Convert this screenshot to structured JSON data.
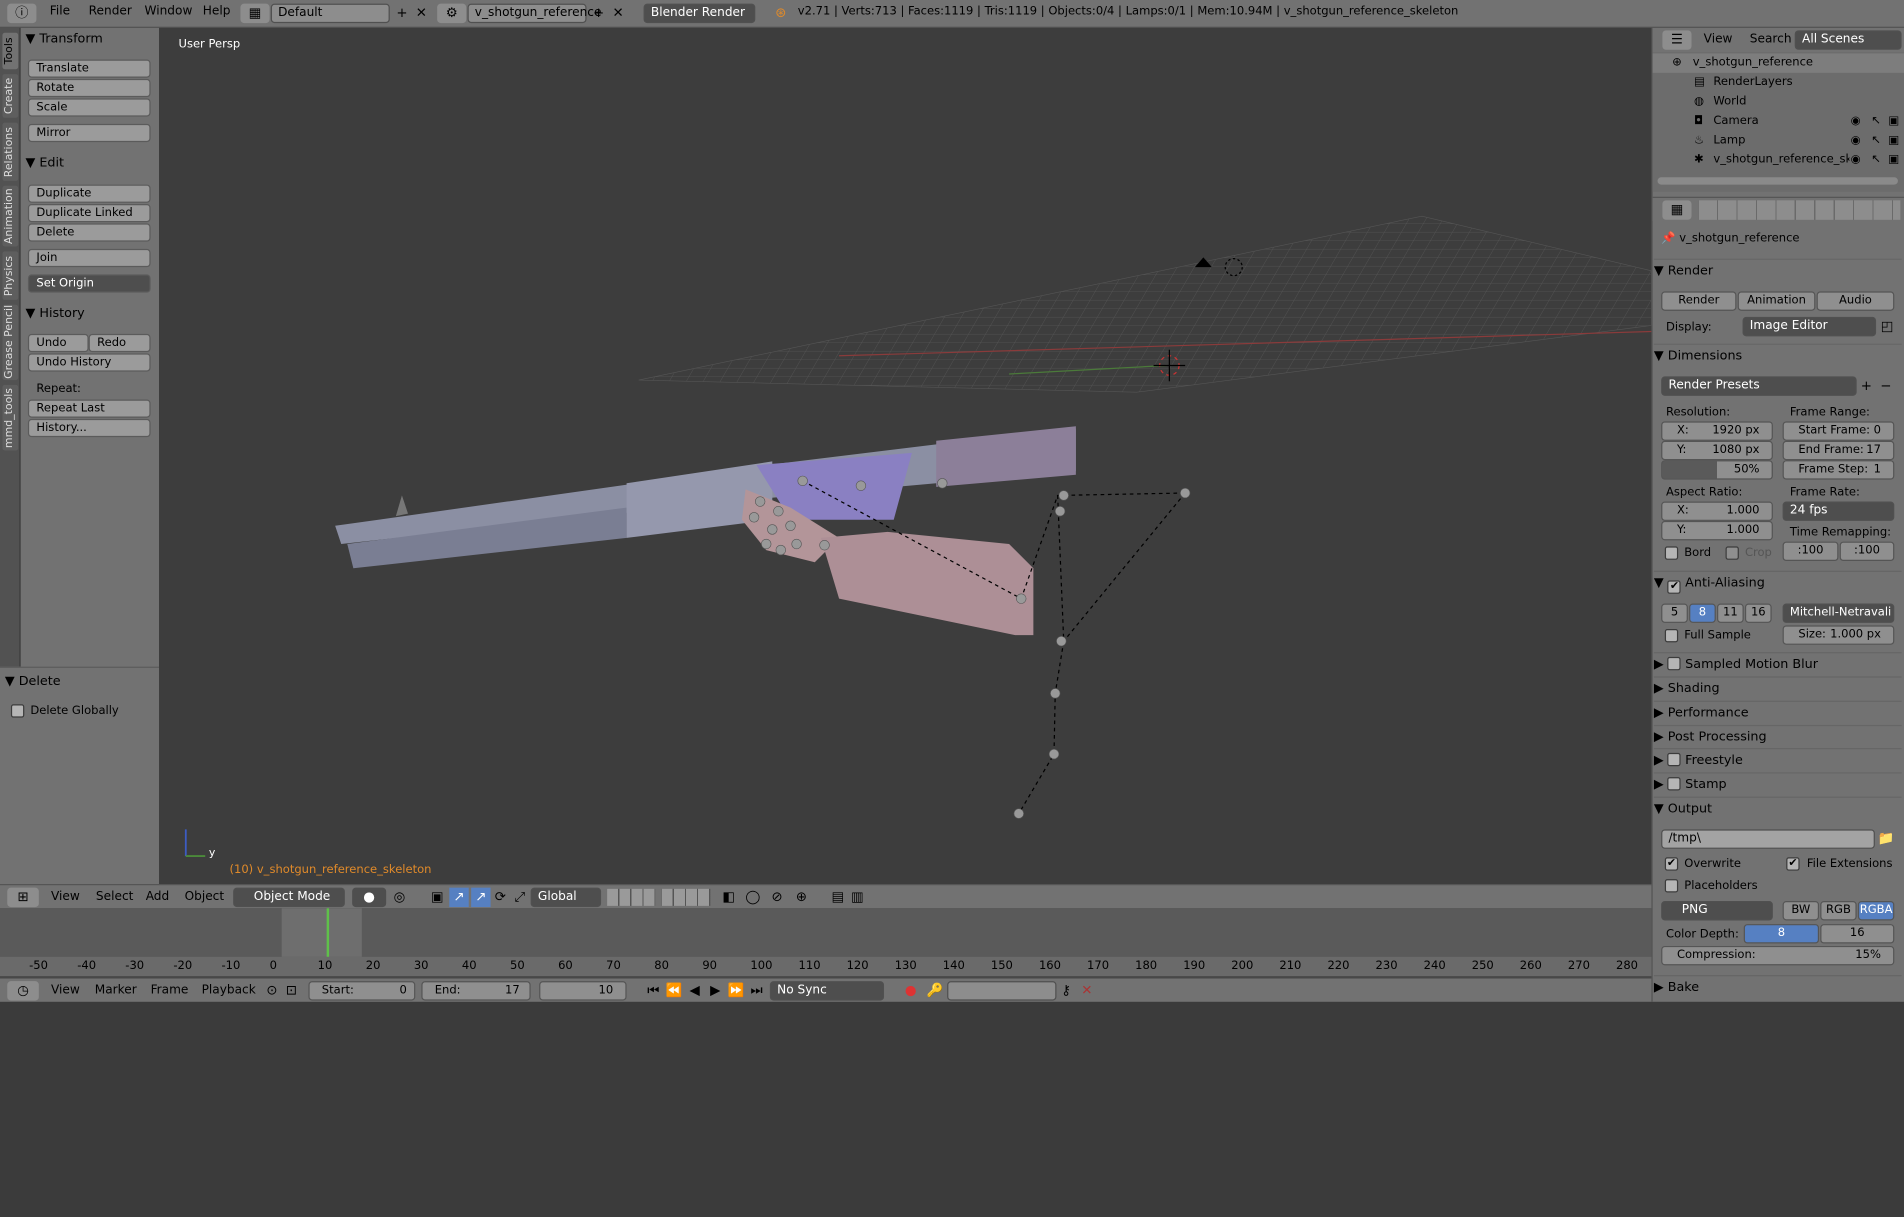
{
  "topbar": {
    "menus": [
      "File",
      "Render",
      "Window",
      "Help"
    ],
    "screen_layout": "Default",
    "scene": "v_shotgun_reference",
    "engine": "Blender Render",
    "stats": "v2.71 | Verts:713 | Faces:1119 | Tris:1119 | Objects:0/4 | Lamps:0/1 | Mem:10.94M | v_shotgun_reference_skeleton"
  },
  "tool_tabs": [
    "Tools",
    "Create",
    "Relations",
    "Animation",
    "Physics",
    "Grease Pencil",
    "mmd_tools"
  ],
  "tool_shelf": {
    "transform_title": "Transform",
    "translate": "Translate",
    "rotate": "Rotate",
    "scale": "Scale",
    "mirror": "Mirror",
    "edit_title": "Edit",
    "duplicate": "Duplicate",
    "duplicate_linked": "Duplicate Linked",
    "delete": "Delete",
    "join": "Join",
    "set_origin": "Set Origin",
    "history_title": "History",
    "undo": "Undo",
    "redo": "Redo",
    "undo_history": "Undo History",
    "repeat_label": "Repeat:",
    "repeat_last": "Repeat Last",
    "history_menu": "History...",
    "op_title": "Delete",
    "delete_globally": "Delete Globally"
  },
  "viewport": {
    "view_name": "User Persp",
    "object_info": "(10) v_shotgun_reference_skeleton",
    "axis_y": "y"
  },
  "view3d_header": {
    "menus": [
      "View",
      "Select",
      "Add",
      "Object"
    ],
    "mode": "Object Mode",
    "orientation": "Global"
  },
  "timeline": {
    "ticks": [
      "-50",
      "-40",
      "-30",
      "-20",
      "-10",
      "0",
      "10",
      "20",
      "30",
      "40",
      "50",
      "60",
      "70",
      "80",
      "90",
      "100",
      "110",
      "120",
      "130",
      "140",
      "150",
      "160",
      "170",
      "180",
      "190",
      "200",
      "210",
      "220",
      "230",
      "240",
      "250",
      "260",
      "270",
      "280"
    ],
    "current_frame_value": 10,
    "menus": [
      "View",
      "Marker",
      "Frame",
      "Playback"
    ],
    "start_label": "Start:",
    "start_value": "0",
    "end_label": "End:",
    "end_value": "17",
    "current": "10",
    "sync": "No Sync"
  },
  "outliner": {
    "menus": [
      "View",
      "Search"
    ],
    "filter": "All Scenes",
    "items": [
      {
        "label": "v_shotgun_reference",
        "indent": 0
      },
      {
        "label": "RenderLayers",
        "indent": 1
      },
      {
        "label": "World",
        "indent": 1
      },
      {
        "label": "Camera",
        "indent": 1
      },
      {
        "label": "Lamp",
        "indent": 1
      },
      {
        "label": "v_shotgun_reference_skele",
        "indent": 1
      }
    ]
  },
  "properties": {
    "context_name": "v_shotgun_reference",
    "render_section": "Render",
    "render_btn": "Render",
    "animation_btn": "Animation",
    "audio_btn": "Audio",
    "display_label": "Display:",
    "display_value": "Image Editor",
    "dimensions_section": "Dimensions",
    "render_presets": "Render Presets",
    "resolution_label": "Resolution:",
    "res_x_label": "X:",
    "res_x": "1920 px",
    "res_y_label": "Y:",
    "res_y": "1080 px",
    "res_pct": "50%",
    "frame_range_label": "Frame Range:",
    "start_frame_label": "Start Frame:",
    "start_frame": "0",
    "end_frame_label": "End Frame:",
    "end_frame": "17",
    "frame_step_label": "Frame Step:",
    "frame_step": "1",
    "aspect_label": "Aspect Ratio:",
    "aspect_x_label": "X:",
    "aspect_x": "1.000",
    "aspect_y_label": "Y:",
    "aspect_y": "1.000",
    "frame_rate_label": "Frame Rate:",
    "frame_rate": "24 fps",
    "time_remap_label": "Time Remapping:",
    "remap_old": ":100",
    "remap_new": ":100",
    "bord": "Bord",
    "crop": "Crop",
    "aa_section": "Anti-Aliasing",
    "aa_samples": [
      "5",
      "8",
      "11",
      "16"
    ],
    "aa_filter": "Mitchell-Netravali",
    "full_sample": "Full Sample",
    "size_label": "Size:",
    "size_value": "1.000 px",
    "motion_blur": "Sampled Motion Blur",
    "shading": "Shading",
    "performance": "Performance",
    "post_processing": "Post Processing",
    "freestyle": "Freestyle",
    "stamp": "Stamp",
    "output_section": "Output",
    "output_path": "/tmp\\",
    "overwrite": "Overwrite",
    "file_extensions": "File Extensions",
    "placeholders": "Placeholders",
    "format": "PNG",
    "bw": "BW",
    "rgb": "RGB",
    "rgba": "RGBA",
    "color_depth_label": "Color Depth:",
    "depth_8": "8",
    "depth_16": "16",
    "compression_label": "Compression:",
    "compression": "15%",
    "bake": "Bake"
  }
}
